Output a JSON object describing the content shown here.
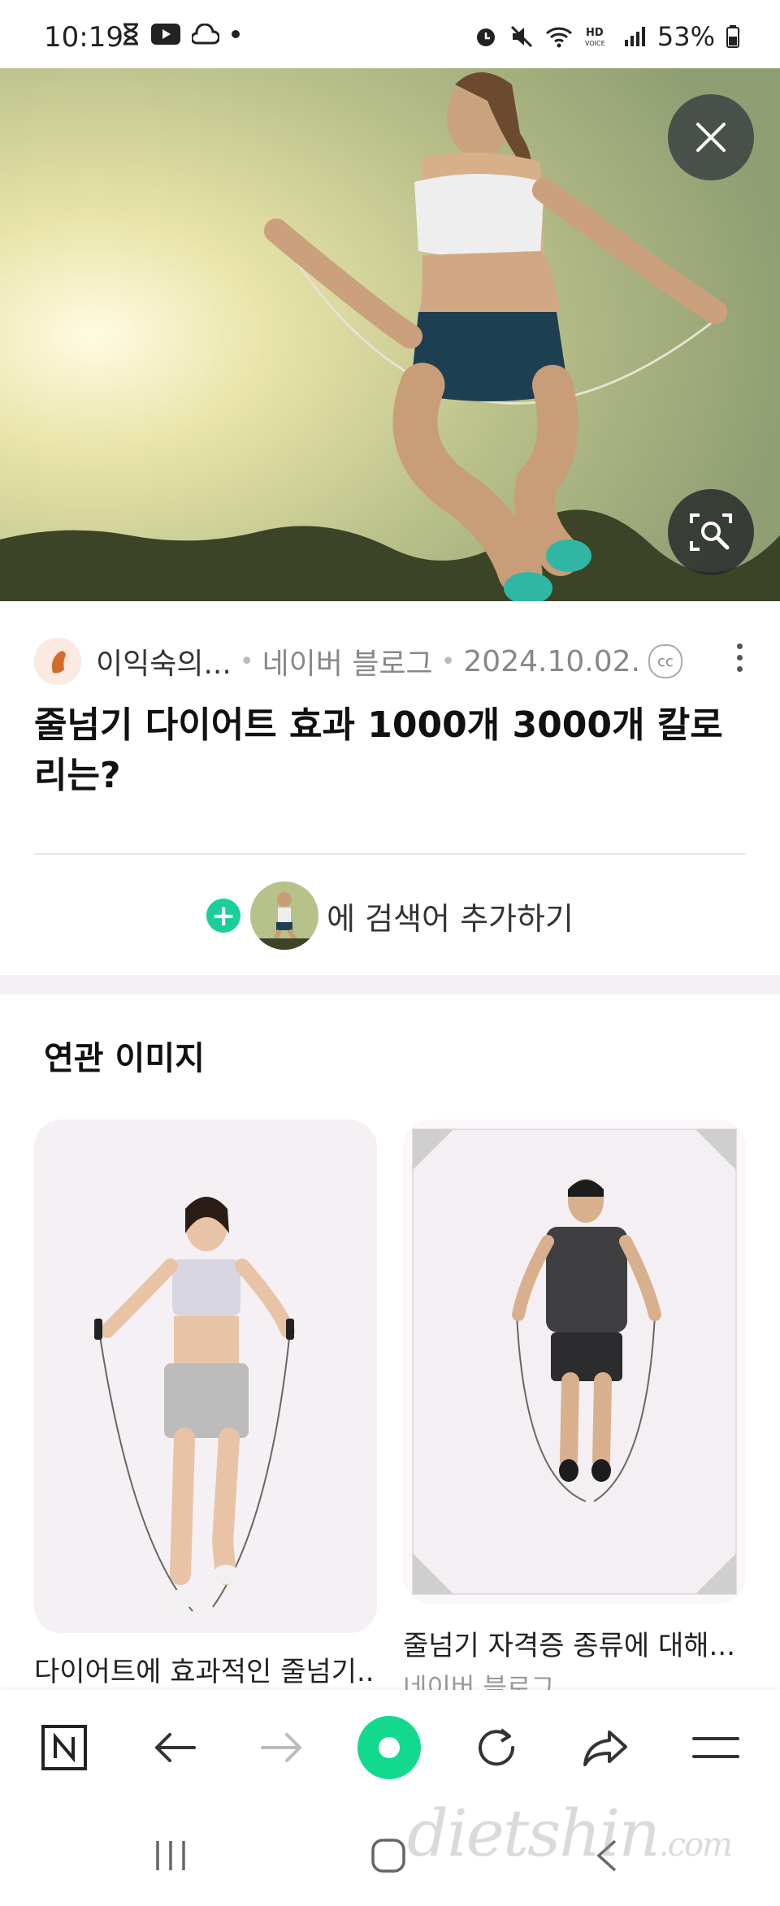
{
  "status_bar": {
    "time": "10:19",
    "battery": "53%",
    "left_icons": [
      "hourglass-icon",
      "youtube-icon",
      "cloud-icon",
      "dot-icon"
    ],
    "right_icons": [
      "alarm-icon",
      "mute-icon",
      "wifi-icon",
      "hd-voice-icon",
      "signal-icon",
      "battery-icon"
    ]
  },
  "hero": {
    "close_icon": "close-icon",
    "lens_icon": "image-search-icon"
  },
  "source": {
    "name": "이익숙의...",
    "platform": "네이버 블로그",
    "date": "2024.10.02.",
    "cc": "cc"
  },
  "article": {
    "title": "줄넘기 다이어트 효과 1000개 3000개 칼로리는?"
  },
  "add_search": {
    "label": "에 검색어 추가하기"
  },
  "related": {
    "title": "연관 이미지",
    "items": [
      {
        "caption": "다이어트에 효과적인 줄넘기..."
      },
      {
        "caption": "줄넘기 자격증 종류에 대해...",
        "source": "네이버 블로그"
      }
    ]
  },
  "toolbar": {
    "items": [
      "naver-home-icon",
      "back-arrow-icon",
      "forward-arrow-icon",
      "green-dot-icon",
      "refresh-icon",
      "share-icon",
      "menu-icon"
    ]
  },
  "nav": {
    "items": [
      "recent-apps-icon",
      "home-icon",
      "back-icon"
    ]
  },
  "watermark": {
    "main": "dietshin",
    "suffix": ".com"
  },
  "colors": {
    "accent_green": "#13d98f",
    "plus_green": "#19ce9b"
  }
}
